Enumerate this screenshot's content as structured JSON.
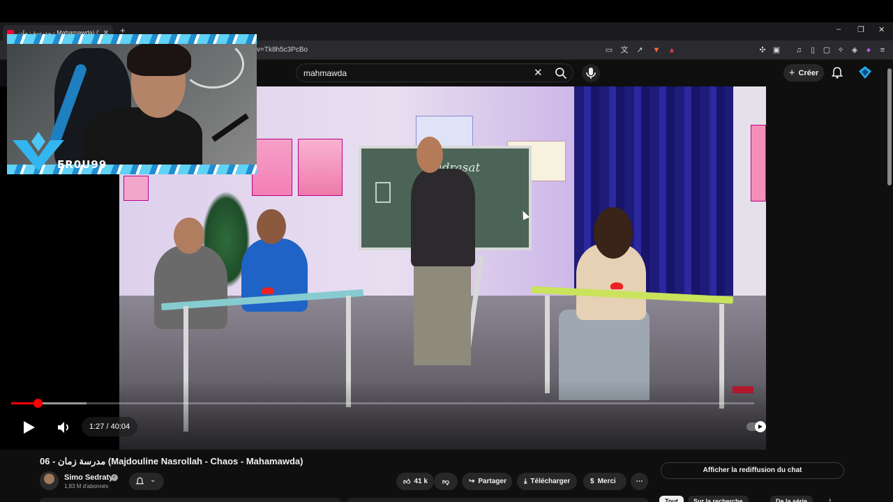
{
  "browser": {
    "tab_title": "مدرسة زمان - Mahamawda) 06",
    "new_tab_icon": "plus-icon",
    "url": "v=Tk8h5c3PcBo",
    "window_controls": {
      "minimize": "–",
      "restore": "❐",
      "close": "✕"
    }
  },
  "youtube": {
    "search_value": "mahmawda",
    "create_label": "Créer",
    "accent_color": "#ff0000"
  },
  "webcam": {
    "streamer_name": "ER0U99"
  },
  "player": {
    "current_time": "1:27",
    "duration": "40:04",
    "time_display": "1:27 / 40:04",
    "progress_fraction": 0.036,
    "buffer_fraction": 0.101,
    "board_text": "Madrasat Zamana"
  },
  "video": {
    "title": "مدرسة زمان - 06 (Majdouline Nasrollah - Chaos - Mahamawda)",
    "channel": "Simo Sedraty",
    "subscribers": "1,83 M d'abonnés",
    "likes": "41 k",
    "share_label": "Partager",
    "download_label": "Télécharger",
    "thanks_label": "Merci",
    "chat_replay_label": "Afficher la rediffusion du chat"
  },
  "chips": [
    "Tout",
    "Sur la recherche",
    "De la série"
  ]
}
